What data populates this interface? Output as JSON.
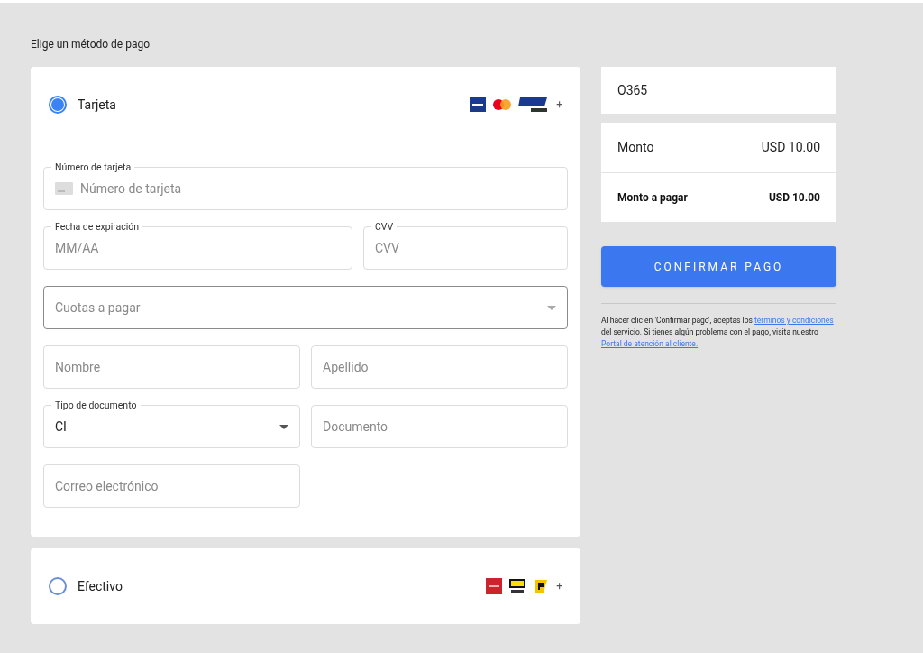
{
  "heading": "Elige un método de pago",
  "methods": [
    {
      "label": "Tarjeta",
      "selected": true,
      "more": "+",
      "rows": [
        {
          "kind": "full",
          "fields": [
            {
              "kind": "card-input",
              "label": "Número de tarjeta",
              "placeholder": "Número de tarjeta"
            }
          ]
        },
        {
          "kind": "wide",
          "fields": [
            {
              "kind": "input",
              "label": "Fecha de expiración",
              "placeholder": "MM/AA"
            },
            {
              "kind": "input",
              "label": "CVV",
              "placeholder": "CVV"
            }
          ]
        },
        {
          "kind": "full",
          "fields": [
            {
              "kind": "select",
              "placeholder": "Cuotas a pagar",
              "focused": true
            }
          ]
        },
        {
          "kind": "halves",
          "fields": [
            {
              "kind": "input",
              "placeholder": "Nombre"
            },
            {
              "kind": "input",
              "placeholder": "Apellido"
            }
          ]
        },
        {
          "kind": "halves",
          "fields": [
            {
              "kind": "select",
              "label": "Tipo de documento",
              "value": "CI"
            },
            {
              "kind": "input",
              "placeholder": "Documento"
            }
          ]
        },
        {
          "kind": "halves",
          "fields": [
            {
              "kind": "input",
              "placeholder": "Correo electrónico"
            }
          ]
        }
      ]
    },
    {
      "label": "Efectivo",
      "selected": false,
      "more": "+"
    }
  ],
  "order": "O365",
  "summary": [
    {
      "kind": "subtotal",
      "label": "Monto",
      "value": "USD 10.00"
    },
    {
      "kind": "total",
      "label": "Monto a pagar",
      "value": "USD 10.00"
    }
  ],
  "button": "CONFIRMAR PAGO",
  "legal": [
    {
      "text": "Al hacer clic en 'Confirmar pago', aceptas los "
    },
    {
      "text": "términos y condiciones",
      "link": true
    },
    {
      "text": " del servicio. Si tienes algún problema con el pago, visita nuestro "
    },
    {
      "text": "Portal de atención al cliente.",
      "link": true
    }
  ]
}
